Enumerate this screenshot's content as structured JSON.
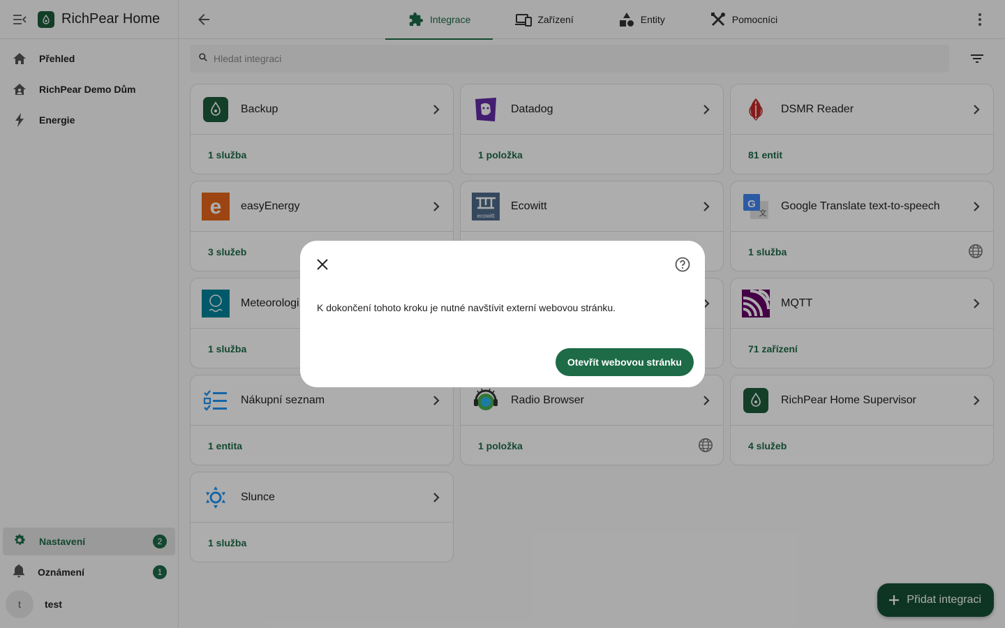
{
  "app": {
    "title": "RichPear Home"
  },
  "sidebar": {
    "items": [
      {
        "label": "Přehled",
        "icon": "home-icon"
      },
      {
        "label": "RichPear Demo Dům",
        "icon": "home-account-icon"
      },
      {
        "label": "Energie",
        "icon": "lightning-icon"
      }
    ],
    "settings": {
      "label": "Nastavení",
      "badge": "2"
    },
    "notifications": {
      "label": "Oznámení",
      "badge": "1"
    },
    "user": {
      "initial": "t",
      "name": "test"
    }
  },
  "tabs": [
    {
      "label": "Integrace",
      "icon": "puzzle-icon",
      "active": true
    },
    {
      "label": "Zařízení",
      "icon": "devices-icon",
      "active": false
    },
    {
      "label": "Entity",
      "icon": "shapes-icon",
      "active": false
    },
    {
      "label": "Pomocníci",
      "icon": "tools-icon",
      "active": false
    }
  ],
  "search": {
    "placeholder": "Hledat integraci",
    "value": ""
  },
  "cards": [
    {
      "name": "Backup",
      "link": "1 služba",
      "icon": "backup-logo-icon",
      "globe": false
    },
    {
      "name": "Datadog",
      "link": "1 položka",
      "icon": "datadog-logo-icon",
      "globe": false
    },
    {
      "name": "DSMR Reader",
      "link": "81 entit",
      "icon": "dsmr-logo-icon",
      "globe": false
    },
    {
      "name": "easyEnergy",
      "link": "3 služeb",
      "icon": "easyenergy-logo-icon",
      "globe": false
    },
    {
      "name": "Ecowitt",
      "link": "",
      "icon": "ecowitt-logo-icon",
      "globe": false
    },
    {
      "name": "Google Translate text-to-speech",
      "link": "1 služba",
      "icon": "google-translate-logo-icon",
      "globe": true
    },
    {
      "name": "Meteorologi",
      "link": "1 služba",
      "icon": "meteorologisk-logo-icon",
      "globe": false
    },
    {
      "name": "",
      "link": "",
      "icon": "",
      "globe": false
    },
    {
      "name": "MQTT",
      "link": "71 zařízení",
      "icon": "mqtt-logo-icon",
      "globe": false
    },
    {
      "name": "Nákupní seznam",
      "link": "1 entita",
      "icon": "shopping-list-logo-icon",
      "globe": false
    },
    {
      "name": "Radio Browser",
      "link": "1 položka",
      "icon": "radio-browser-logo-icon",
      "globe": true
    },
    {
      "name": "RichPear Home Supervisor",
      "link": "4 služeb",
      "icon": "supervisor-logo-icon",
      "globe": false
    },
    {
      "name": "Slunce",
      "link": "1 služba",
      "icon": "sun-logo-icon",
      "globe": false
    }
  ],
  "dialog": {
    "text": "K dokončení tohoto kroku je nutné navštívit externí webovou stránku.",
    "button": "Otevřít webovou stránku"
  },
  "fab": {
    "label": "Přidat integraci"
  },
  "colors": {
    "accent": "#1d6b47",
    "fab": "#164f34",
    "overlay": "rgba(0,0,0,0.32)"
  }
}
